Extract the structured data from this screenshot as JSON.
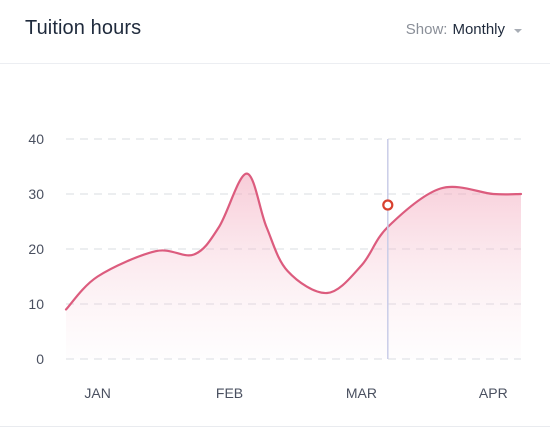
{
  "header": {
    "title": "Tuition hours",
    "show_label": "Show:",
    "show_value": "Monthly"
  },
  "colors": {
    "line": "#dc5c7e",
    "marker_stroke": "#d8412f",
    "grid": "#d9dce2",
    "crosshair": "#c9cde8"
  },
  "chart_data": {
    "type": "area",
    "title": "Tuition hours",
    "xlabel": "",
    "ylabel": "",
    "categories": [
      "JAN",
      "FEB",
      "MAR",
      "APR"
    ],
    "xlim": [
      -0.24,
      3.21
    ],
    "ylim": [
      0,
      40
    ],
    "yticks": [
      0,
      10,
      20,
      30,
      40
    ],
    "grid": true,
    "series": [
      {
        "x": [
          -0.24,
          0.0,
          0.44,
          0.73,
          0.92,
          1.13,
          1.28,
          1.44,
          1.74,
          2.0,
          2.2,
          2.6,
          3.0,
          3.21
        ],
        "values": [
          9,
          15,
          19.6,
          19,
          24,
          33.7,
          24,
          16,
          12,
          17,
          24,
          31,
          30,
          30
        ]
      }
    ],
    "highlight": {
      "x": 2.2,
      "y": 28
    }
  }
}
